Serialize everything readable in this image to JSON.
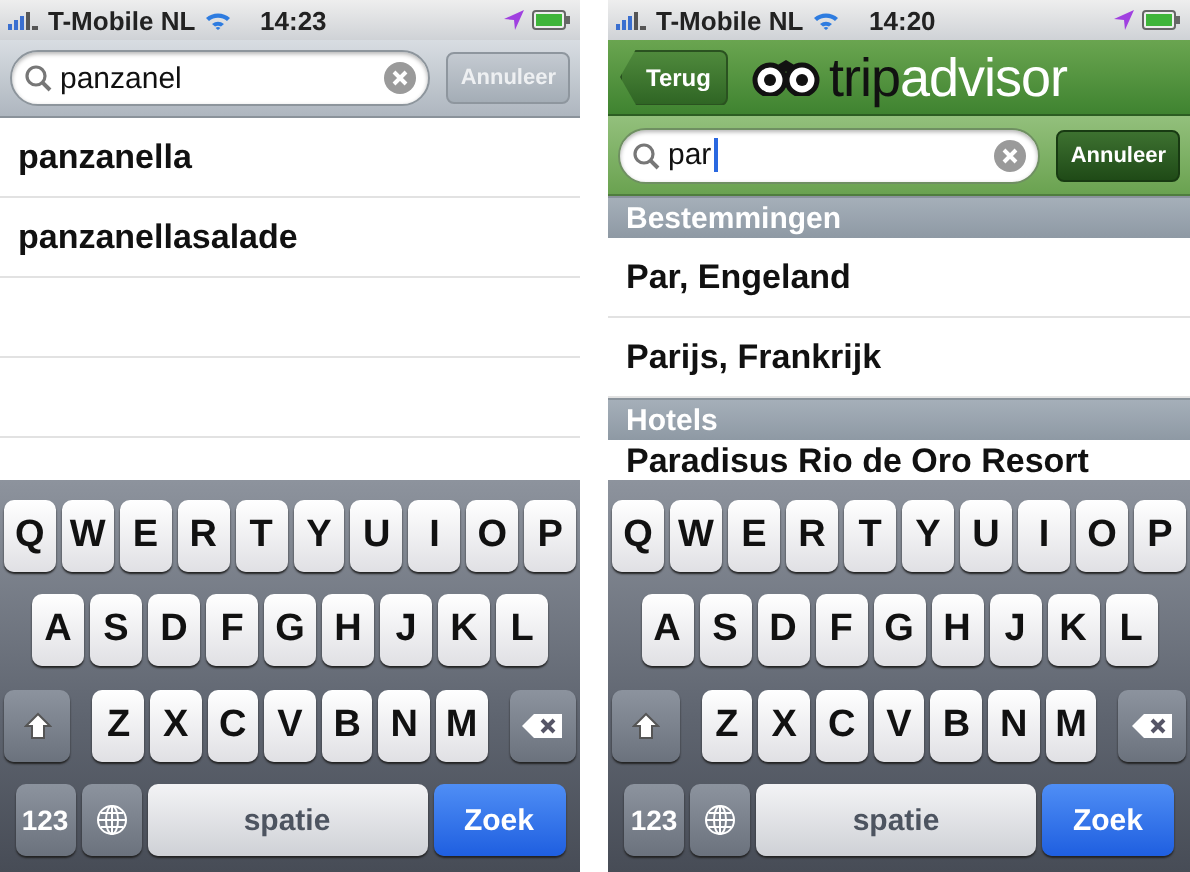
{
  "phones": [
    {
      "kind": "plain",
      "status": {
        "carrier": "T-Mobile NL",
        "time": "14:23"
      },
      "search": {
        "value": "panzanel",
        "focused": false,
        "cancel": "Annuleer",
        "cancel_disabled": true
      },
      "sections": [
        {
          "items": [
            "panzanella",
            "panzanellasalade"
          ]
        }
      ],
      "keyboard": {
        "rows": [
          {
            "keys": [
              {
                "kind": "letter",
                "label": "Q"
              },
              {
                "kind": "letter",
                "label": "W"
              },
              {
                "kind": "letter",
                "label": "E"
              },
              {
                "kind": "letter",
                "label": "R"
              },
              {
                "kind": "letter",
                "label": "T"
              },
              {
                "kind": "letter",
                "label": "Y"
              },
              {
                "kind": "letter",
                "label": "U"
              },
              {
                "kind": "letter",
                "label": "I"
              },
              {
                "kind": "letter",
                "label": "O"
              },
              {
                "kind": "letter",
                "label": "P"
              }
            ]
          },
          {
            "keys": [
              {
                "kind": "letter",
                "label": "A"
              },
              {
                "kind": "letter",
                "label": "S"
              },
              {
                "kind": "letter",
                "label": "D"
              },
              {
                "kind": "letter",
                "label": "F"
              },
              {
                "kind": "letter",
                "label": "G"
              },
              {
                "kind": "letter",
                "label": "H"
              },
              {
                "kind": "letter",
                "label": "J"
              },
              {
                "kind": "letter",
                "label": "K"
              },
              {
                "kind": "letter",
                "label": "L"
              }
            ]
          },
          {
            "keys": [
              {
                "kind": "shift"
              },
              {
                "kind": "letter",
                "label": "Z"
              },
              {
                "kind": "letter",
                "label": "X"
              },
              {
                "kind": "letter",
                "label": "C"
              },
              {
                "kind": "letter",
                "label": "V"
              },
              {
                "kind": "letter",
                "label": "B"
              },
              {
                "kind": "letter",
                "label": "N"
              },
              {
                "kind": "letter",
                "label": "M"
              },
              {
                "kind": "delete"
              }
            ]
          },
          {
            "keys": [
              {
                "kind": "numbers",
                "label": "123"
              },
              {
                "kind": "globe"
              },
              {
                "kind": "space",
                "label": "spatie"
              },
              {
                "kind": "return",
                "label": "Zoek"
              }
            ]
          }
        ]
      }
    },
    {
      "kind": "branded",
      "status": {
        "carrier": "T-Mobile NL",
        "time": "14:20"
      },
      "nav": {
        "back": "Terug",
        "logo": [
          "trip",
          "advisor"
        ]
      },
      "search": {
        "value": "par",
        "focused": true,
        "cancel": "Annuleer",
        "cancel_disabled": false
      },
      "sections": [
        {
          "title": "Bestemmingen",
          "items": [
            "Par, Engeland",
            "Parijs, Frankrijk"
          ]
        },
        {
          "title": "Hotels",
          "items": [
            "Paradisus Rio de Oro Resort"
          ]
        }
      ],
      "keyboard": {
        "rows": [
          {
            "keys": [
              {
                "kind": "letter",
                "label": "Q"
              },
              {
                "kind": "letter",
                "label": "W"
              },
              {
                "kind": "letter",
                "label": "E"
              },
              {
                "kind": "letter",
                "label": "R"
              },
              {
                "kind": "letter",
                "label": "T"
              },
              {
                "kind": "letter",
                "label": "Y"
              },
              {
                "kind": "letter",
                "label": "U"
              },
              {
                "kind": "letter",
                "label": "I"
              },
              {
                "kind": "letter",
                "label": "O"
              },
              {
                "kind": "letter",
                "label": "P"
              }
            ]
          },
          {
            "keys": [
              {
                "kind": "letter",
                "label": "A"
              },
              {
                "kind": "letter",
                "label": "S"
              },
              {
                "kind": "letter",
                "label": "D"
              },
              {
                "kind": "letter",
                "label": "F"
              },
              {
                "kind": "letter",
                "label": "G"
              },
              {
                "kind": "letter",
                "label": "H"
              },
              {
                "kind": "letter",
                "label": "J"
              },
              {
                "kind": "letter",
                "label": "K"
              },
              {
                "kind": "letter",
                "label": "L"
              }
            ]
          },
          {
            "keys": [
              {
                "kind": "shift"
              },
              {
                "kind": "letter",
                "label": "Z"
              },
              {
                "kind": "letter",
                "label": "X"
              },
              {
                "kind": "letter",
                "label": "C"
              },
              {
                "kind": "letter",
                "label": "V"
              },
              {
                "kind": "letter",
                "label": "B"
              },
              {
                "kind": "letter",
                "label": "N"
              },
              {
                "kind": "letter",
                "label": "M"
              },
              {
                "kind": "delete"
              }
            ]
          },
          {
            "keys": [
              {
                "kind": "numbers",
                "label": "123"
              },
              {
                "kind": "globe"
              },
              {
                "kind": "space",
                "label": "spatie"
              },
              {
                "kind": "return",
                "label": "Zoek"
              }
            ]
          }
        ]
      }
    }
  ]
}
